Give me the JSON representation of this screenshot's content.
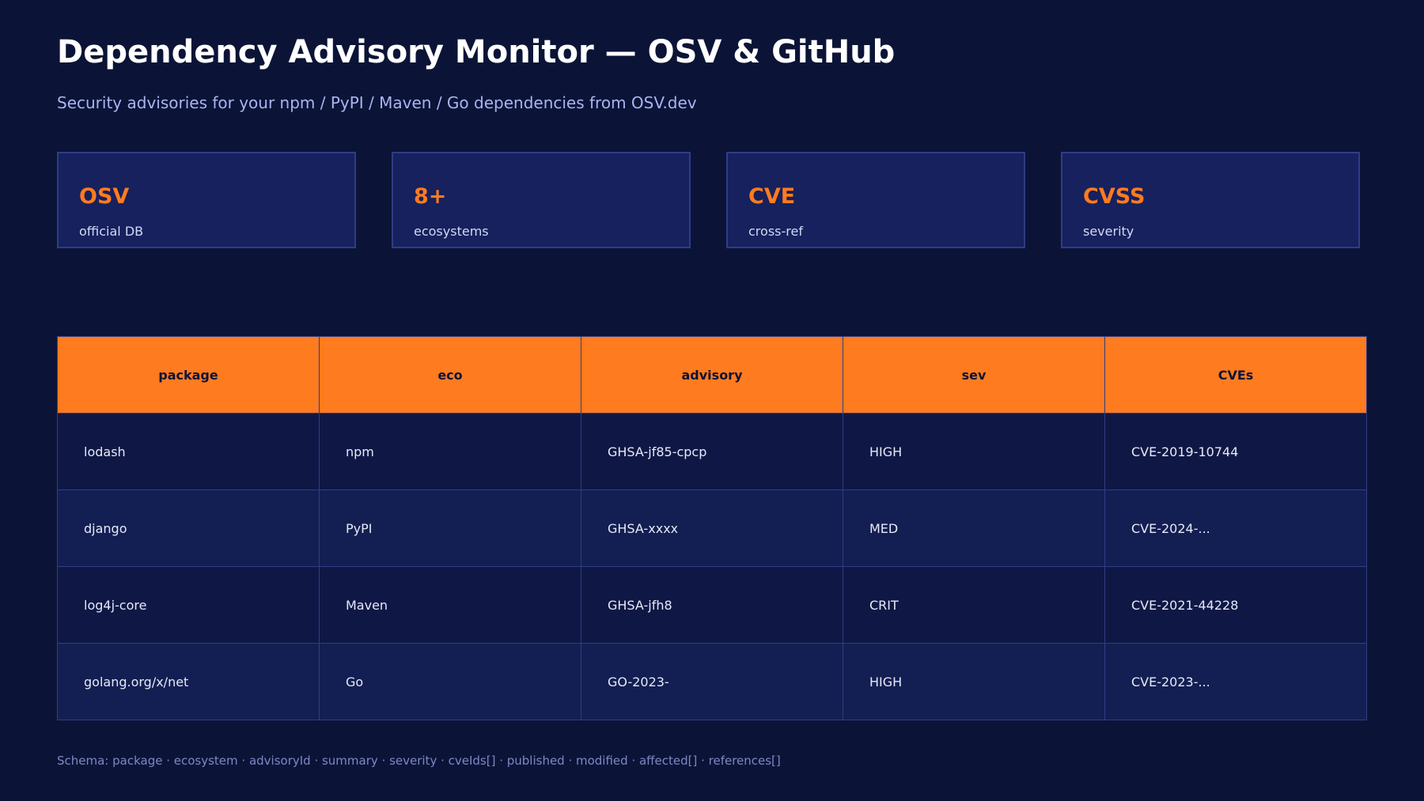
{
  "header": {
    "title": "Dependency Advisory Monitor — OSV & GitHub",
    "subtitle": "Security advisories for your npm / PyPI / Maven / Go dependencies from OSV.dev"
  },
  "stats": [
    {
      "value": "OSV",
      "label": "official DB"
    },
    {
      "value": "8+",
      "label": "ecosystems"
    },
    {
      "value": "CVE",
      "label": "cross-ref"
    },
    {
      "value": "CVSS",
      "label": "severity"
    }
  ],
  "table": {
    "columns": [
      "package",
      "eco",
      "advisory",
      "sev",
      "CVEs"
    ],
    "rows": [
      [
        "lodash",
        "npm",
        "GHSA-jf85-cpcp",
        "HIGH",
        "CVE-2019-10744"
      ],
      [
        "django",
        "PyPI",
        "GHSA-xxxx",
        "MED",
        "CVE-2024-..."
      ],
      [
        "log4j-core",
        "Maven",
        "GHSA-jfh8",
        "CRIT",
        "CVE-2021-44228"
      ],
      [
        "golang.org/x/net",
        "Go",
        "GO-2023-",
        "HIGH",
        "CVE-2023-..."
      ]
    ]
  },
  "footer": {
    "schema": "Schema: package · ecosystem · advisoryId · summary · severity · cveIds[] · published · modified · affected[] · references[]"
  },
  "colors": {
    "background": "#0b1437",
    "accent": "#ff7b1f",
    "card": "#16215e",
    "border": "#2f3d86"
  }
}
